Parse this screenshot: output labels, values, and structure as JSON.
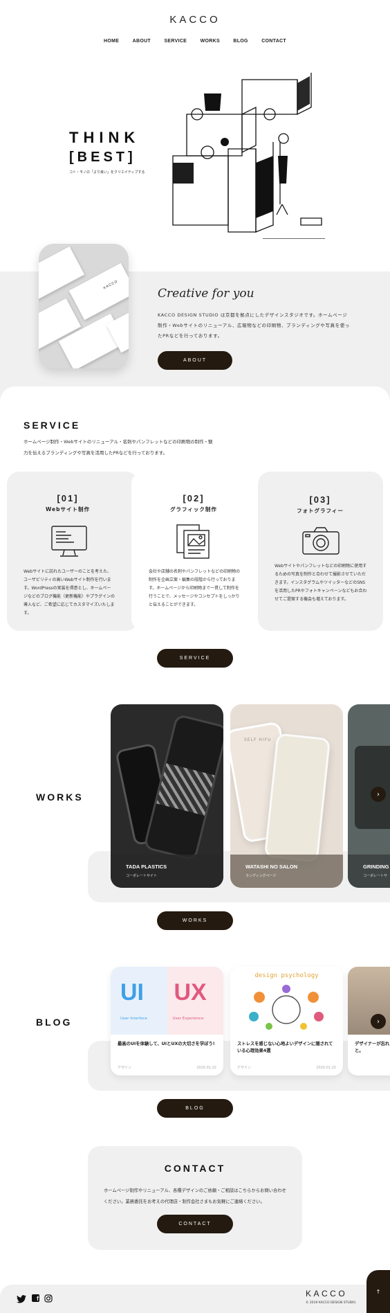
{
  "header": {
    "logo": "KACCO",
    "nav": [
      "HOME",
      "ABOUT",
      "SERVICE",
      "WORKS",
      "BLOG",
      "CONTACT"
    ]
  },
  "hero": {
    "title_line1": "THINK",
    "title_line2": "[BEST]",
    "subtitle": "コト・モノの「より良い」をクリエイティブする"
  },
  "about": {
    "script_title": "Creative for you",
    "text": "KACCO DESIGN STUDIO は京都を拠点にしたデザインスタジオです。ホームページ制作・Webサイトのリニューアル、広報物などの印刷物、ブランディングや写真を使ったPRなどを行っております。",
    "button": "ABOUT",
    "card_brand": "KACCO"
  },
  "service": {
    "title": "SERVICE",
    "intro": "ホームページ制作・Webサイトのリニューアル・名刺やパンフレットなどの印刷物の制作・魅力を伝えるブランディングや写真を活用したPRなどを行っております。",
    "items": [
      {
        "num": "[01]",
        "name": "Webサイト制作",
        "icon": "monitor-icon",
        "text": "Webサイトに訪れたユーザーのことを考えた、ユーザビリティの高いWebサイト制作を行います。WordPressの実装を得意とし、ホームページなどのブログ機能（更新機能）やプラグインの導入など、ご希望に応じてカスタマイズいたします。"
      },
      {
        "num": "[02]",
        "name": "グラフィック制作",
        "icon": "print-icon",
        "text": "会社や店舗の名刺やパンフレットなどの印刷物の制作を企画立案・編集の段階から行っております。ホームページから印刷物まで一貫して制作を行うことで、メッセージやコンセプトをしっかりと伝えることができます。"
      },
      {
        "num": "[03]",
        "name": "フォトグラフィー",
        "icon": "camera-icon",
        "text": "Webサイトやパンフレットなどの印刷物に使用するための写真を制作と合わせて撮影させていただきます。インスタグラムやツイッターなどのSNSを活用したPRやフォトキャンペーンなどもお合わせてご提案する機会も増えております。"
      }
    ],
    "button": "SERVICE"
  },
  "works": {
    "title": "WORKS",
    "items": [
      {
        "name": "TADA PLASTICS",
        "category": "コーポレートサイト"
      },
      {
        "name": "WATASHI NO SALON",
        "category": "ランディングページ"
      },
      {
        "name": "GRINDING",
        "category": "コーポレートサ"
      }
    ],
    "screen_text": "SELF HIFU",
    "button": "WORKS"
  },
  "blog": {
    "title": "BLOG",
    "items": [
      {
        "title": "最高のUIを体験して、UIとUXの大切さを学ぼう!",
        "category": "デザイン",
        "date": "2020.01.22",
        "img_left": "UI",
        "img_right": "UX",
        "cap_left": "User Interface",
        "cap_right": "User Experience"
      },
      {
        "title": "ストレスを感じない心地よいデザインに隠されている心理効果4選",
        "category": "デザイン",
        "date": "2020.01.22",
        "img_title": "design psychology"
      },
      {
        "title": "デザイナーが忘れと。",
        "category": "",
        "date": ""
      }
    ],
    "button": "BLOG"
  },
  "contact": {
    "title": "CONTACT",
    "text": "ホームページ制作やリニューアル、各種デザインのご依頼・ご相談はこちらからお問い合わせください。業務委託をお考えの代理店・制作会社さまもお気軽にご連絡ください。",
    "button": "CONTACT"
  },
  "footer": {
    "logo": "KACCO",
    "copyright": "© 2019 KACCO DESIGN STUDIO.",
    "social": [
      "twitter-icon",
      "facebook-icon",
      "instagram-icon"
    ],
    "top_arrow": "↑"
  },
  "colors": {
    "dark": "#241a10",
    "panel": "#f0f0f0",
    "ui_blue": "#3fa0e8",
    "ux_pink": "#e05a7e"
  }
}
